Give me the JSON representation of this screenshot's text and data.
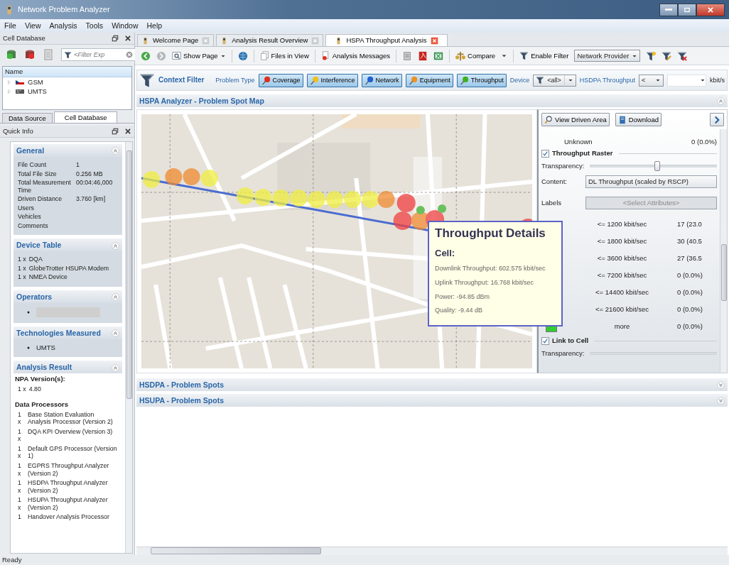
{
  "window": {
    "title": "Network Problem Analyzer"
  },
  "menu": [
    "File",
    "View",
    "Analysis",
    "Tools",
    "Window",
    "Help"
  ],
  "cell_database": {
    "title": "Cell Database",
    "filter_placeholder": "<Filter Exp",
    "tree_header": "Name",
    "tree": [
      {
        "label": "GSM",
        "expanded": false
      },
      {
        "label": "UMTS",
        "expanded": false
      }
    ]
  },
  "left_tabs": [
    {
      "label": "Data Source",
      "selected": false
    },
    {
      "label": "Cell Database",
      "selected": true
    }
  ],
  "quick_info": {
    "title": "Quick Info",
    "sections": [
      {
        "kind": "table",
        "title": "General",
        "expanded": true,
        "rows": [
          {
            "label": "File Count",
            "value": "1"
          },
          {
            "label": "Total File Size",
            "value": "0.256 MB"
          },
          {
            "label": "Total Measurement Time",
            "value": "00:04:46,000"
          },
          {
            "label": "Driven Distance",
            "value": "3.760 [km]"
          },
          {
            "label": "Users"
          },
          {
            "label": "Vehicles"
          },
          {
            "label": "Comments"
          }
        ]
      },
      {
        "kind": "counted",
        "title": "Device Table",
        "expanded": true,
        "items": [
          {
            "qty": "1 x",
            "name": "DQA"
          },
          {
            "qty": "1 x",
            "name": "GlobeTrotter HSUPA Modem"
          },
          {
            "qty": "1 x",
            "name": "NMEA Device"
          }
        ]
      },
      {
        "kind": "bullets",
        "title": "Operators",
        "expanded": true,
        "items": [
          {
            "redacted": true
          }
        ]
      },
      {
        "kind": "bullets",
        "title": "Technologies Measured",
        "expanded": true,
        "items": [
          {
            "text": "UMTS"
          }
        ]
      },
      {
        "kind": "analysis",
        "title": "Analysis Result",
        "expanded": true,
        "npa_heading": "NPA Version(s):",
        "npa": [
          {
            "qty": "1 x",
            "name": "4.80"
          }
        ],
        "processors_heading": "Data Processors",
        "processors": [
          {
            "qty": "1 x",
            "name": "Base Station Evaluation Analysis Processor (Version 2)"
          },
          {
            "qty": "1 x",
            "name": "DQA KPI Overview (Version 3)"
          },
          {
            "qty": "1 x",
            "name": "Default GPS Processor (Version 1)"
          },
          {
            "qty": "1 x",
            "name": "EGPRS Throughput Analyzer (Version 2)"
          },
          {
            "qty": "1 x",
            "name": "HSDPA Throughput Analyzer (Version 2)"
          },
          {
            "qty": "1 x",
            "name": "HSUPA Throughput Analyzer (Version 2)"
          },
          {
            "qty": "1",
            "name": "Handover Analysis Processor"
          }
        ]
      }
    ]
  },
  "doc_tabs": [
    {
      "label": "Welcome Page",
      "selected": false
    },
    {
      "label": "Analysis Result Overview",
      "selected": false
    },
    {
      "label": "HSPA Throughput Analysis",
      "selected": true
    }
  ],
  "toolbar": {
    "show_page": "Show Page",
    "files_in_view": "Files in View",
    "analysis_messages": "Analysis Messages",
    "compare": "Compare",
    "enable_filter": "Enable Filter",
    "provider": "Network Provider"
  },
  "context_filter": {
    "title": "Context Filter",
    "problem_type_label": "Problem Type",
    "problem_types": [
      {
        "label": "Coverage",
        "selected": true,
        "color": "#e03020"
      },
      {
        "label": "Interference",
        "selected": true,
        "color": "#f0c020"
      },
      {
        "label": "Network",
        "selected": true,
        "color": "#2060d0"
      },
      {
        "label": "Equipment",
        "selected": true,
        "color": "#f09020"
      },
      {
        "label": "Throughput",
        "selected": true,
        "color": "#40b020"
      }
    ],
    "device_label": "Device",
    "device_value": "<all>",
    "throughput_label": "HSDPA Throughput",
    "operator": "<",
    "unit": "kbit/s"
  },
  "panels": [
    {
      "title": "HSPA Analyzer - Problem Spot Map",
      "expanded": true,
      "map_view": {
        "buttons": [
          "View Driven Area",
          "Download"
        ],
        "layer_rows": [
          {
            "kind": "count",
            "label": "Unknown",
            "value": "0 (0.0%)"
          },
          {
            "kind": "group",
            "label": "Throughput Raster",
            "checked": true
          },
          {
            "kind": "slider",
            "label": "Transparency:",
            "level": 0.53
          },
          {
            "kind": "select",
            "label": "Content:",
            "value": "DL Throughput (scaled by RSCP)"
          },
          {
            "kind": "select",
            "label": "Labels",
            "placeholder": "<Select Attributes>",
            "disabled": true
          },
          {
            "kind": "legend",
            "label": "<= 1200 kbit/sec",
            "value": "17 (23.0"
          },
          {
            "kind": "legend",
            "label": "<= 1800 kbit/sec",
            "value": "30 (40.5"
          },
          {
            "kind": "legend",
            "label": "<= 3600 kbit/sec",
            "value": "27 (36.5"
          },
          {
            "kind": "legend",
            "label": "<= 7200 kbit/sec",
            "value": "0 (0.0%)"
          },
          {
            "kind": "legend",
            "label": "<= 14400 kbit/sec",
            "value": "0 (0.0%)"
          },
          {
            "kind": "legend",
            "label": "<= 21600 kbit/sec",
            "value": "0 (0.0%)"
          },
          {
            "kind": "legend",
            "label": "more",
            "value": "0 (0.0%)",
            "color": "#33cc33"
          },
          {
            "kind": "group",
            "label": "Link to Cell",
            "checked": true
          },
          {
            "kind": "slider",
            "label": "Transparency:"
          }
        ],
        "tooltip": {
          "title": "Throughput Details",
          "subtitle": "Cell:",
          "lines": [
            "Downlink Throughput: 602.575 kbit/sec",
            "Uplink Throughput: 16.768 kbit/sec",
            "Power: -94.85 dBm",
            "Quality: -9.44 dB"
          ]
        }
      }
    },
    {
      "title": "HSDPA - Problem Spots",
      "expanded": false
    },
    {
      "title": "HSUPA - Problem Spots",
      "expanded": false
    }
  ],
  "status_bar": "Ready"
}
